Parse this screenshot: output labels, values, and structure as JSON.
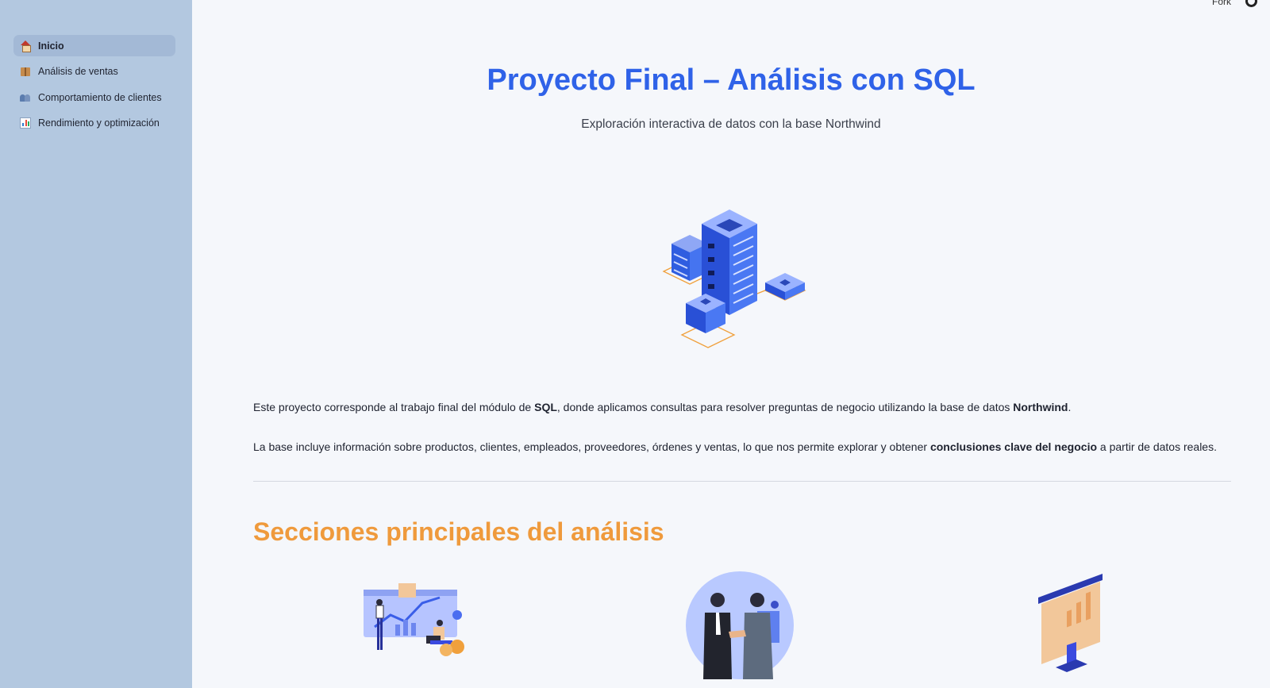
{
  "sidebar": {
    "items": [
      {
        "label": "Inicio",
        "icon": "house-icon",
        "active": true
      },
      {
        "label": "Análisis de ventas",
        "icon": "package-icon",
        "active": false
      },
      {
        "label": "Comportamiento de clientes",
        "icon": "people-icon",
        "active": false
      },
      {
        "label": "Rendimiento y optimización",
        "icon": "bar-chart-icon",
        "active": false
      }
    ]
  },
  "header": {
    "fork_label": "Fork",
    "github_icon": "github-icon"
  },
  "main": {
    "title": "Proyecto Final – Análisis con SQL",
    "subtitle": "Exploración interactiva de datos con la base Northwind",
    "hero_icon": "database-servers-illustration",
    "paragraph1": {
      "part1": "Este proyecto corresponde al trabajo final del módulo de ",
      "bold1": "SQL",
      "part2": ", donde aplicamos consultas para resolver preguntas de negocio utilizando la base de datos ",
      "bold2": "Northwind",
      "part3": "."
    },
    "paragraph2": {
      "part1": "La base incluye información sobre productos, clientes, empleados, proveedores, órdenes y ventas, lo que nos permite explorar y obtener ",
      "bold1": "conclusiones clave del negocio",
      "part2": " a partir de datos reales."
    },
    "section_title": "Secciones principales del análisis",
    "section_images": [
      "sales-analysis-illustration",
      "customer-handshake-illustration",
      "performance-board-illustration"
    ]
  },
  "colors": {
    "sidebar_bg": "#b3c8e0",
    "title": "#2f62e8",
    "section_title": "#ef9a3c",
    "page_bg": "#f5f7fb"
  }
}
